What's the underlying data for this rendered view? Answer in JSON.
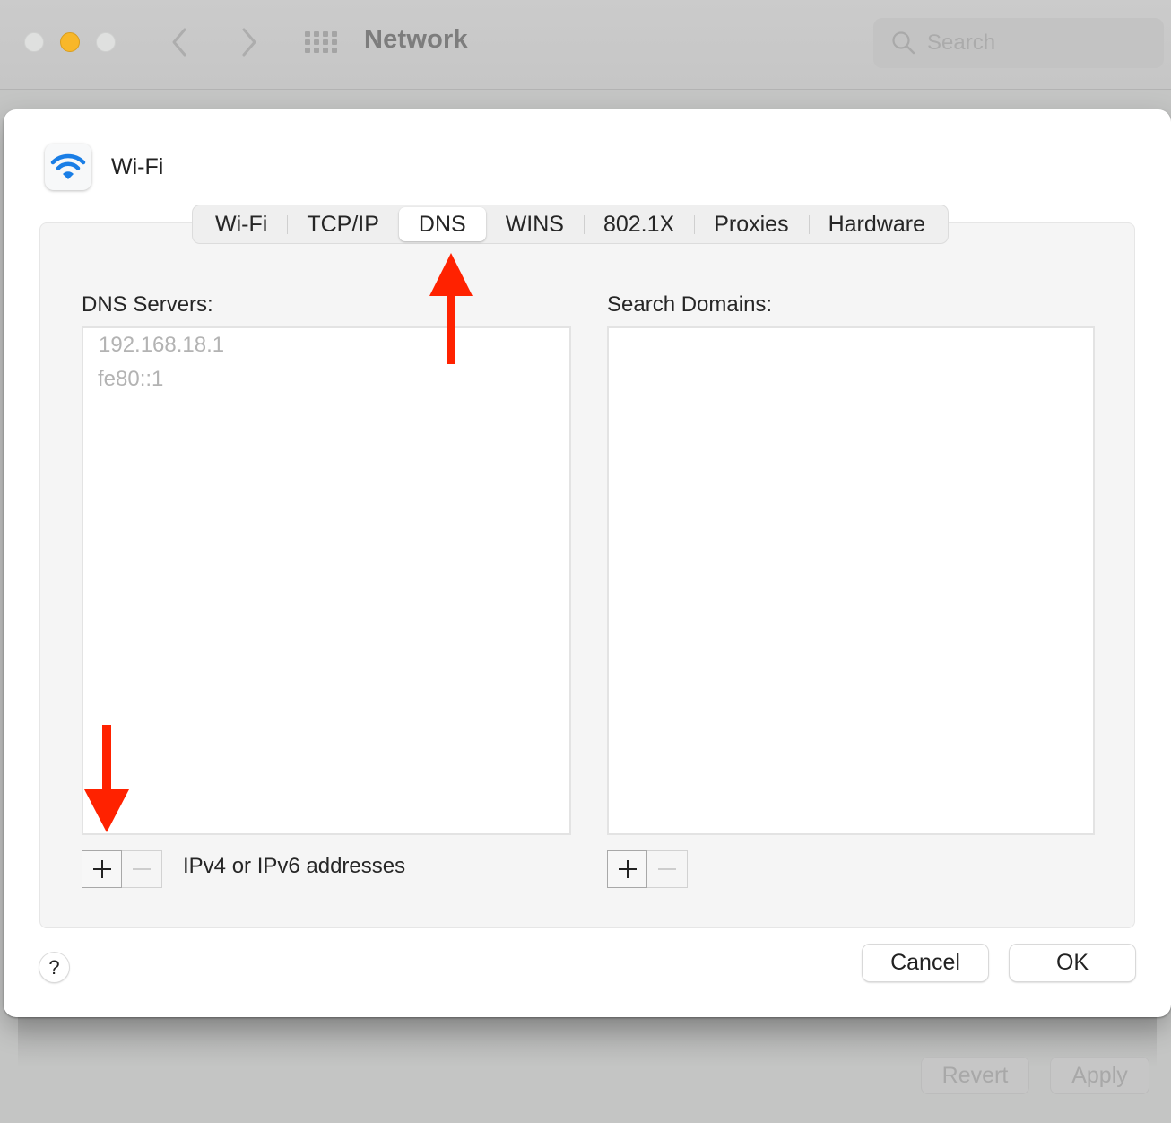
{
  "window": {
    "title": "Network",
    "search_placeholder": "Search",
    "traffic_lights": [
      "close",
      "minimize",
      "zoom"
    ],
    "bottom_buttons": {
      "revert": "Revert",
      "apply": "Apply"
    }
  },
  "sheet": {
    "service_name": "Wi-Fi",
    "service_icon": "wifi-icon",
    "tabs": [
      {
        "label": "Wi-Fi",
        "active": false
      },
      {
        "label": "TCP/IP",
        "active": false
      },
      {
        "label": "DNS",
        "active": true
      },
      {
        "label": "WINS",
        "active": false
      },
      {
        "label": "802.1X",
        "active": false
      },
      {
        "label": "Proxies",
        "active": false
      },
      {
        "label": "Hardware",
        "active": false
      }
    ],
    "dns_servers": {
      "label": "DNS Servers:",
      "items": [
        "192.168.18.1",
        "fe80::1"
      ],
      "hint": "IPv4 or IPv6 addresses"
    },
    "search_domains": {
      "label": "Search Domains:",
      "items": []
    },
    "buttons": {
      "help": "?",
      "cancel": "Cancel",
      "ok": "OK"
    }
  },
  "annotations": {
    "color": "#ff2200",
    "arrows": [
      {
        "direction": "up",
        "target": "DNS tab"
      },
      {
        "direction": "down",
        "target": "add DNS server button"
      }
    ]
  },
  "colors": {
    "accent_wifi": "#1a7ee6",
    "traffic_min": "#f8b729"
  }
}
